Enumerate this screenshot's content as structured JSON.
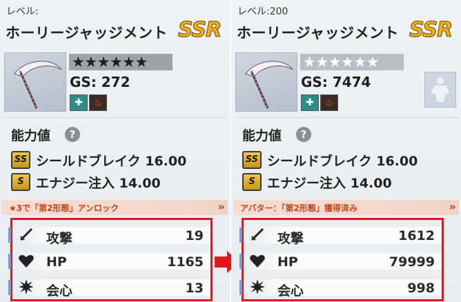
{
  "left": {
    "level_label": "レベル:",
    "weapon_name": "ホーリージャッジメント",
    "rarity": "SSR",
    "stars": "★★★★★★",
    "gs": "GS: 272",
    "section_title": "能力値",
    "help": "?",
    "attributes": [
      {
        "badge": "SS",
        "text": "シールドブレイク 16.00"
      },
      {
        "badge": "S",
        "text": "エナジー注入 14.00"
      }
    ],
    "banner": "★3で「第2形態」アンロック",
    "banner_arrow": "»",
    "stats": [
      {
        "name": "攻撃",
        "value": "19",
        "icon": "sword-icon"
      },
      {
        "name": "HP",
        "value": "1165",
        "icon": "heart-icon"
      },
      {
        "name": "会心",
        "value": "13",
        "icon": "burst-icon"
      }
    ]
  },
  "right": {
    "level_label": "レベル:200",
    "weapon_name": "ホーリージャッジメント",
    "rarity": "SSR",
    "stars": "★★★★★★",
    "gs": "GS: 7474",
    "section_title": "能力値",
    "help": "?",
    "attributes": [
      {
        "badge": "SS",
        "text": "シールドブレイク 16.00"
      },
      {
        "badge": "S",
        "text": "エナジー注入 14.00"
      }
    ],
    "banner": "アバター：「第2形態」獲得済み",
    "banner_arrow": "»",
    "stats": [
      {
        "name": "攻撃",
        "value": "1612",
        "icon": "sword-icon"
      },
      {
        "name": "HP",
        "value": "79999",
        "icon": "heart-icon"
      },
      {
        "name": "会心",
        "value": "998",
        "icon": "burst-icon"
      }
    ]
  },
  "colors": {
    "highlight_border": "#e3141b",
    "rarity_gold": "#f2b21e",
    "banner_text": "#c2441c",
    "skill_teal": "#2f8c86"
  }
}
